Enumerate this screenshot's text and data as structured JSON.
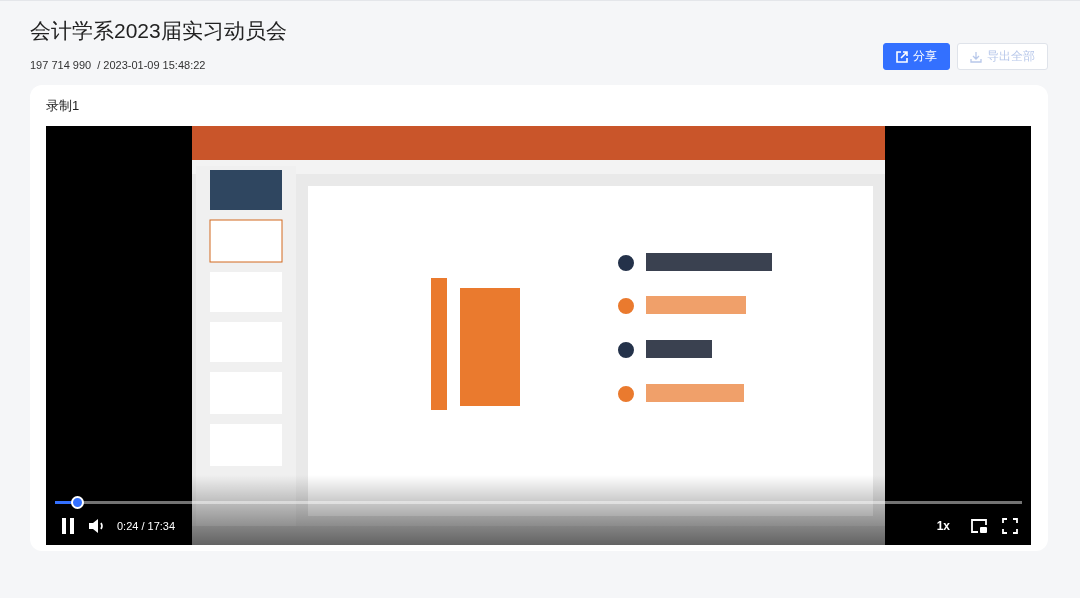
{
  "page": {
    "title": "会计学系2023届实习动员会",
    "meta_id": "197 714 990",
    "meta_date": "/ 2023-01-09 15:48:22"
  },
  "actions": [
    {
      "label": "分享",
      "disabled": false
    },
    {
      "label": "导出全部",
      "disabled": true
    }
  ],
  "recording": {
    "title": "录制1",
    "video": {
      "kind": "picture",
      "playing": true,
      "progress": {
        "level": 0.023
      },
      "time": "0:24 / 17:34",
      "speed": "1x"
    }
  }
}
